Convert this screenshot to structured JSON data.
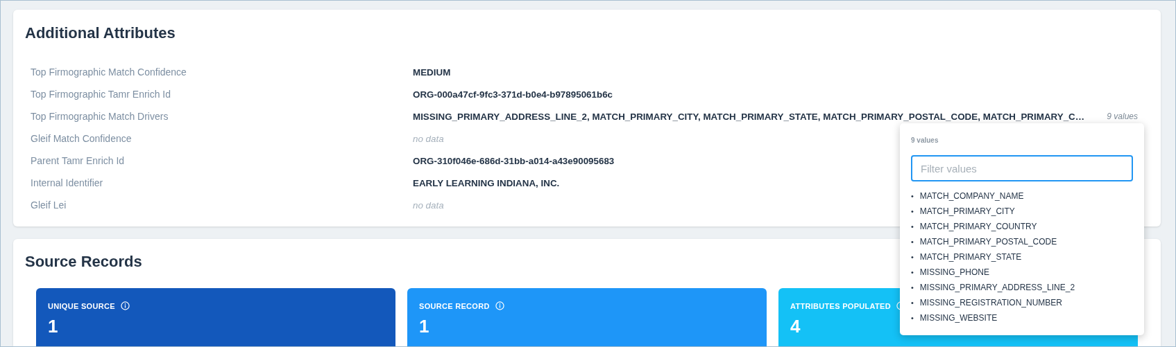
{
  "additional_attributes": {
    "title": "Additional Attributes",
    "rows": [
      {
        "label": "Top Firmographic Match Confidence",
        "kind": "text",
        "value": "MEDIUM"
      },
      {
        "label": "Top Firmographic Tamr Enrich Id",
        "kind": "text",
        "value": "ORG-000a47cf-9fc3-371d-b0e4-b97895061b6c"
      },
      {
        "label": "Top Firmographic Match Drivers",
        "kind": "multi",
        "value": "MISSING_PRIMARY_ADDRESS_LINE_2, MATCH_PRIMARY_CITY, MATCH_PRIMARY_STATE, MATCH_PRIMARY_POSTAL_CODE, MATCH_PRIMARY_C…",
        "count": "9 values"
      },
      {
        "label": "Gleif Match Confidence",
        "kind": "empty",
        "value": "no data"
      },
      {
        "label": "Parent Tamr Enrich Id",
        "kind": "text",
        "value": "ORG-310f046e-686d-31bb-a014-a43e90095683"
      },
      {
        "label": "Internal Identifier",
        "kind": "text",
        "value": "EARLY LEARNING INDIANA, INC."
      },
      {
        "label": "Gleif Lei",
        "kind": "empty",
        "value": "no data"
      }
    ]
  },
  "source_records": {
    "title": "Source Records",
    "stats": [
      {
        "label": "UNIQUE SOURCE",
        "value": "1",
        "color": "#1358bb"
      },
      {
        "label": "SOURCE RECORD",
        "value": "1",
        "color": "#1e96f8"
      },
      {
        "label": "ATTRIBUTES POPULATED",
        "value": "4",
        "color": "#14c1f6"
      }
    ]
  },
  "values_popover": {
    "heading": "9 values",
    "bullet": "•",
    "filter": {
      "placeholder": "Filter values",
      "focused": true
    },
    "items": [
      "MATCH_COMPANY_NAME",
      "MATCH_PRIMARY_CITY",
      "MATCH_PRIMARY_COUNTRY",
      "MATCH_PRIMARY_POSTAL_CODE",
      "MATCH_PRIMARY_STATE",
      "MISSING_PHONE",
      "MISSING_PRIMARY_ADDRESS_LINE_2",
      "MISSING_REGISTRATION_NUMBER",
      "MISSING_WEBSITE"
    ]
  }
}
